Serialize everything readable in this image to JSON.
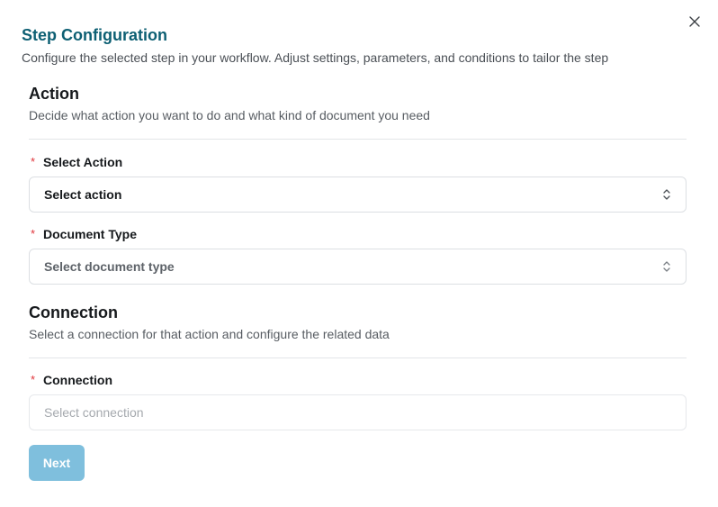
{
  "dialog": {
    "title": "Step Configuration",
    "subtitle": "Configure the selected step in your workflow. Adjust settings, parameters, and conditions to tailor the step",
    "close_icon": "close-icon"
  },
  "sections": {
    "action": {
      "title": "Action",
      "description": "Decide what action you want to do and what kind of document you need",
      "fields": {
        "select_action": {
          "required_mark": "*",
          "label": "Select Action",
          "value": "Select action"
        },
        "document_type": {
          "required_mark": "*",
          "label": "Document Type",
          "value": "Select document type"
        }
      }
    },
    "connection": {
      "title": "Connection",
      "description": "Select a connection for that action and configure the related data",
      "fields": {
        "connection": {
          "required_mark": "*",
          "label": "Connection",
          "placeholder": "Select connection"
        }
      }
    }
  },
  "footer": {
    "next_label": "Next"
  },
  "colors": {
    "title": "#0d5f73",
    "required": "#e0343a",
    "next_button_disabled": "#7fbfdd"
  }
}
